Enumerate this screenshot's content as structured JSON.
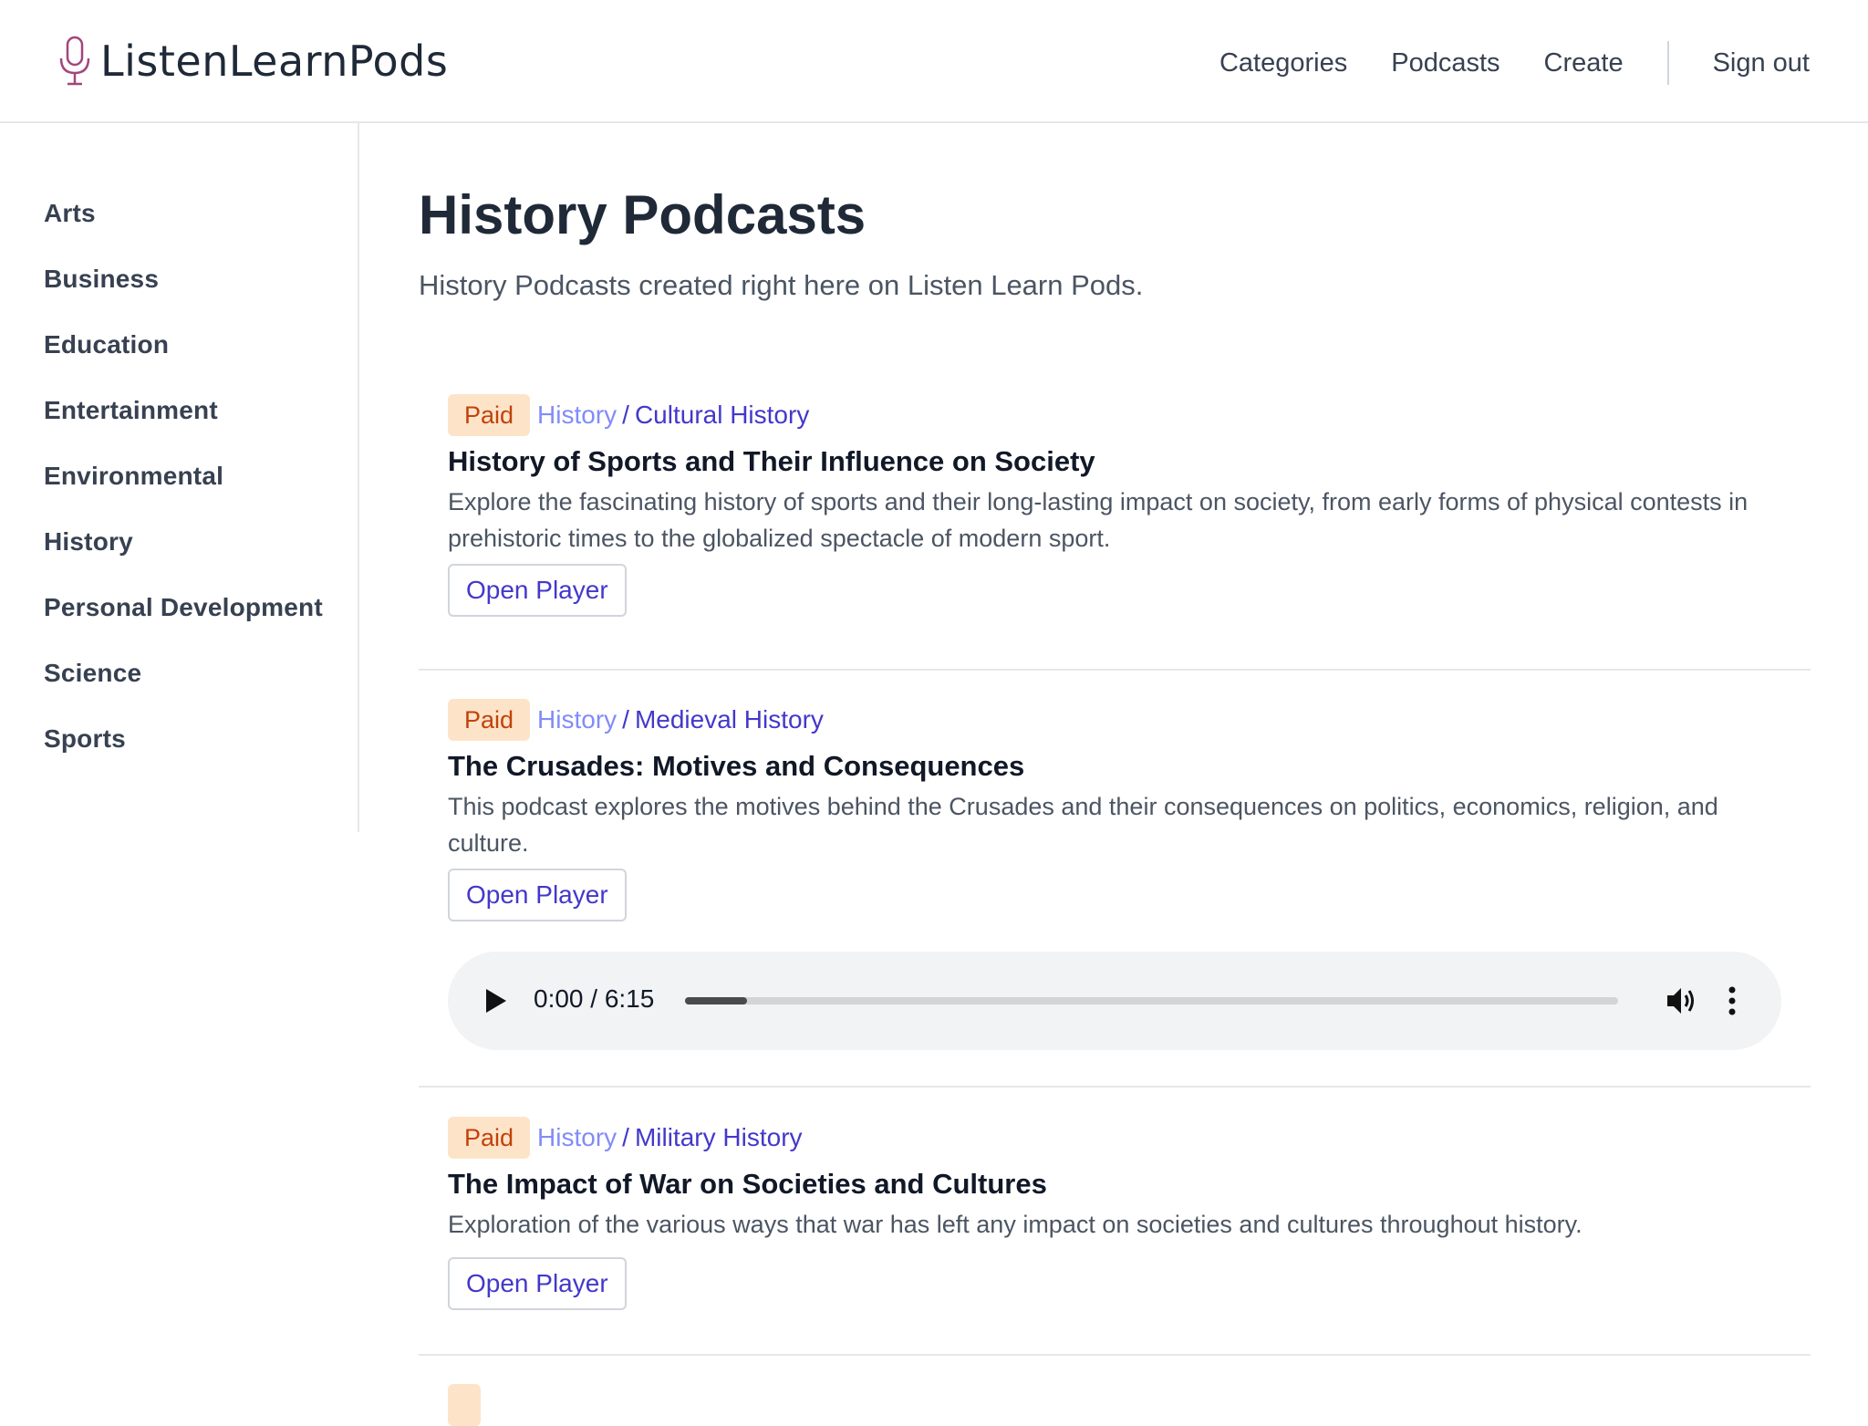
{
  "header": {
    "brand": "ListenLearnPods",
    "nav": [
      "Categories",
      "Podcasts",
      "Create"
    ],
    "signout": "Sign out"
  },
  "sidebar": {
    "items": [
      "Arts",
      "Business",
      "Education",
      "Entertainment",
      "Environmental",
      "History",
      "Personal Development",
      "Science",
      "Sports"
    ]
  },
  "page": {
    "title": "History Podcasts",
    "description": "History Podcasts created right here on Listen Learn Pods."
  },
  "cards": [
    {
      "badge": "Paid",
      "category": "History",
      "separator": "/",
      "subcategory": "Cultural History",
      "title": "History of Sports and Their Influence on Society",
      "description": "Explore the fascinating history of sports and their long-lasting impact on society, from early forms of physical contests in prehistoric times to the globalized spectacle of modern sport.",
      "button": "Open Player"
    },
    {
      "badge": "Paid",
      "category": "History",
      "separator": "/",
      "subcategory": "Medieval History",
      "title": "The Crusades: Motives and Consequences",
      "description": "This podcast explores the motives behind the Crusades and their consequences on politics, economics, religion, and culture.",
      "button": "Open Player",
      "player": {
        "time": "0:00 / 6:15",
        "buffered_fraction": 0.066
      }
    },
    {
      "badge": "Paid",
      "category": "History",
      "separator": "/",
      "subcategory": "Military History",
      "title": "The Impact of War on Societies and Cultures",
      "description": "Exploration of the various ways that war has left any impact on societies and cultures throughout history.",
      "button": "Open Player"
    }
  ],
  "colors": {
    "accent": "#4338ca",
    "badge_bg": "#fde4c8",
    "badge_text": "#c2410c",
    "logo": "#a3467a"
  }
}
